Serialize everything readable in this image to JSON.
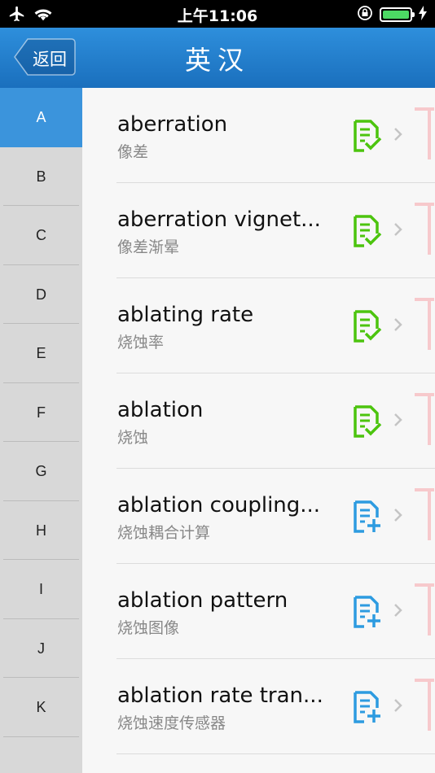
{
  "status_bar": {
    "time": "上午11:06",
    "icons": [
      "airplane-icon",
      "wifi-icon",
      "orientation-lock-icon",
      "battery-icon",
      "charging-icon"
    ]
  },
  "nav": {
    "back_label": "返回",
    "title": "英汉"
  },
  "index": {
    "letters": [
      "A",
      "B",
      "C",
      "D",
      "E",
      "F",
      "G",
      "H",
      "I",
      "J",
      "K"
    ],
    "active": "A"
  },
  "entries": [
    {
      "word": "aberration",
      "translation": "像差",
      "state": "added"
    },
    {
      "word": "aberration vignet...",
      "translation": "像差渐晕",
      "state": "added"
    },
    {
      "word": "ablating rate",
      "translation": "烧蚀率",
      "state": "added"
    },
    {
      "word": "ablation",
      "translation": "烧蚀",
      "state": "added"
    },
    {
      "word": "ablation coupling...",
      "translation": "烧蚀耦合计算",
      "state": "add"
    },
    {
      "word": "ablation pattern",
      "translation": "烧蚀图像",
      "state": "add"
    },
    {
      "word": "ablation rate tran...",
      "translation": "烧蚀速度传感器",
      "state": "add"
    }
  ],
  "colors": {
    "nav_top": "#2e8fdc",
    "nav_bottom": "#1a6fbd",
    "index_active": "#3b94dc",
    "added_icon": "#4cc40e",
    "add_icon": "#2d9be0",
    "ribbon": "#f7c9cc"
  }
}
